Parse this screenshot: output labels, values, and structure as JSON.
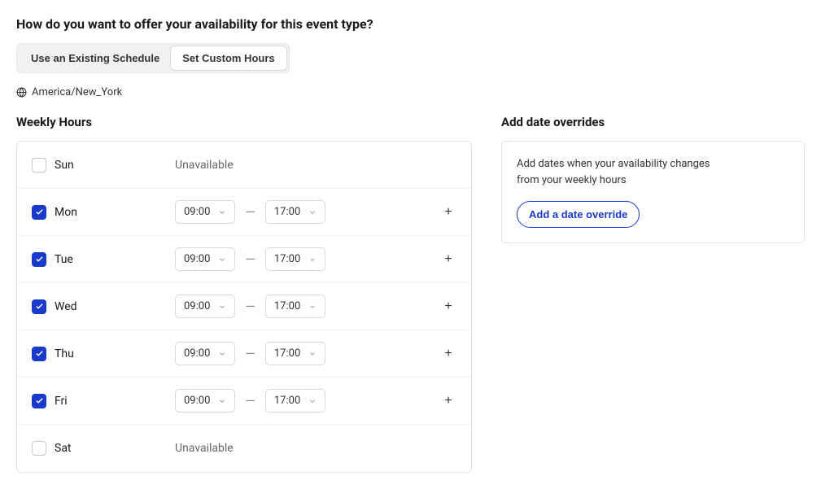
{
  "heading": "How do you want to offer your availability for this event type?",
  "segmented": {
    "existing": "Use an Existing Schedule",
    "custom": "Set Custom Hours"
  },
  "timezone": "America/New_York",
  "weekly_title": "Weekly Hours",
  "unavailable_label": "Unavailable",
  "dash": "—",
  "days": [
    {
      "name": "Sun",
      "enabled": false
    },
    {
      "name": "Mon",
      "enabled": true,
      "start": "09:00",
      "end": "17:00"
    },
    {
      "name": "Tue",
      "enabled": true,
      "start": "09:00",
      "end": "17:00"
    },
    {
      "name": "Wed",
      "enabled": true,
      "start": "09:00",
      "end": "17:00"
    },
    {
      "name": "Thu",
      "enabled": true,
      "start": "09:00",
      "end": "17:00"
    },
    {
      "name": "Fri",
      "enabled": true,
      "start": "09:00",
      "end": "17:00"
    },
    {
      "name": "Sat",
      "enabled": false
    }
  ],
  "overrides": {
    "title": "Add date overrides",
    "message": "Add dates when your availability changes from your weekly hours",
    "button": "Add a date override"
  }
}
